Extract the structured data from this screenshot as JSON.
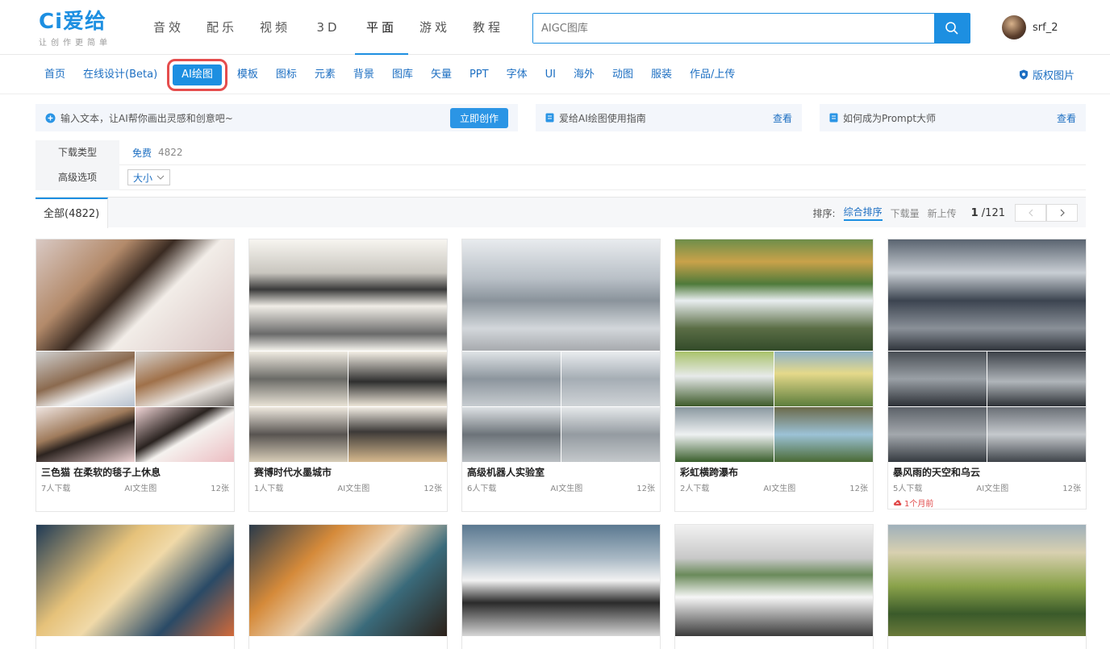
{
  "header": {
    "logo_text": "Ci爱给",
    "slogan": "让创作更简单",
    "nav": [
      {
        "label": "音效",
        "active": false
      },
      {
        "label": "配乐",
        "active": false
      },
      {
        "label": "视频",
        "active": false
      },
      {
        "label": "3D",
        "active": false
      },
      {
        "label": "平面",
        "active": true
      },
      {
        "label": "游戏",
        "active": false
      },
      {
        "label": "教程",
        "active": false
      }
    ],
    "search": {
      "value": "",
      "placeholder": "AIGC图库"
    },
    "user": {
      "name": "srf_2"
    }
  },
  "subnav": {
    "items": [
      {
        "label": "首页",
        "active": false
      },
      {
        "label": "在线设计(Beta)",
        "active": false
      },
      {
        "label": "AI绘图",
        "active": true
      },
      {
        "label": "模板",
        "active": false
      },
      {
        "label": "图标",
        "active": false
      },
      {
        "label": "元素",
        "active": false
      },
      {
        "label": "背景",
        "active": false
      },
      {
        "label": "图库",
        "active": false
      },
      {
        "label": "矢量",
        "active": false
      },
      {
        "label": "PPT",
        "active": false
      },
      {
        "label": "字体",
        "active": false
      },
      {
        "label": "UI",
        "active": false
      },
      {
        "label": "海外",
        "active": false
      },
      {
        "label": "动图",
        "active": false
      },
      {
        "label": "服装",
        "active": false
      },
      {
        "label": "作品/上传",
        "active": false
      }
    ],
    "copyright_label": "版权图片"
  },
  "banners": {
    "prompt_text": "输入文本，让AI帮你画出灵感和创意吧~",
    "create_label": "立即创作",
    "guide_text": "爱给AI绘图使用指南",
    "guide_link": "查看",
    "master_text": "如何成为Prompt大师",
    "master_link": "查看"
  },
  "filters": {
    "download_type_label": "下载类型",
    "download_type_value": "免费",
    "download_type_count": "4822",
    "advanced_label": "高级选项",
    "size_label": "大小"
  },
  "tabbar": {
    "all_tab": "全部(4822)",
    "sort_label": "排序:",
    "sort_options": [
      {
        "label": "综合排序",
        "active": true
      },
      {
        "label": "下载量",
        "active": false
      },
      {
        "label": "新上传",
        "active": false
      }
    ],
    "page_current": "1",
    "page_total": "/121"
  },
  "cards": [
    {
      "title": "三色猫 在柔软的毯子上休息",
      "downloads": "7人下载",
      "type": "AI文生图",
      "count": "12张",
      "badge": ""
    },
    {
      "title": "赛博时代水墨城市",
      "downloads": "1人下载",
      "type": "AI文生图",
      "count": "12张",
      "badge": ""
    },
    {
      "title": "高级机器人实验室",
      "downloads": "6人下载",
      "type": "AI文生图",
      "count": "12张",
      "badge": ""
    },
    {
      "title": "彩虹横跨瀑布",
      "downloads": "2人下载",
      "type": "AI文生图",
      "count": "12张",
      "badge": ""
    },
    {
      "title": "暴风雨的天空和乌云",
      "downloads": "5人下载",
      "type": "AI文生图",
      "count": "12张",
      "badge": "1个月前"
    }
  ],
  "colors": {
    "accent": "#1d8fe1",
    "link": "#1d6fc2",
    "highlight_outline": "#e54d4d",
    "hot": "#e04848"
  }
}
